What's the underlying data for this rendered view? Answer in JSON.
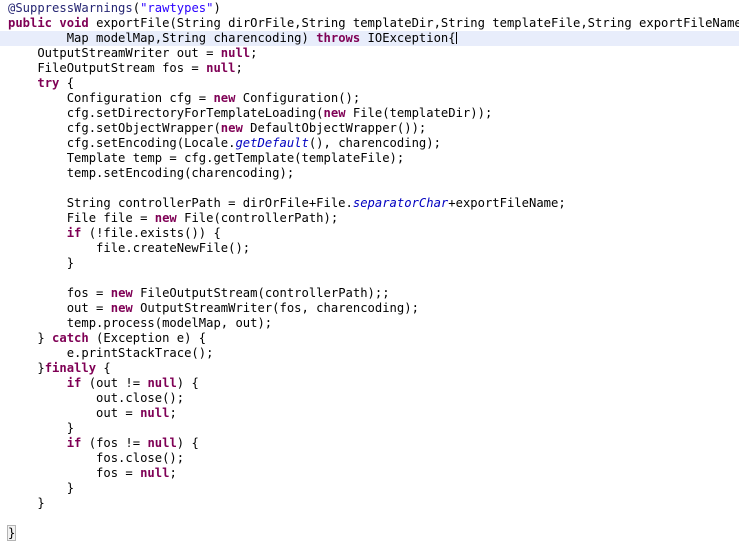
{
  "editor": {
    "language": "java",
    "theme": {
      "background": "#ffffff",
      "foreground": "#000000",
      "keyword": "#7f0055",
      "string": "#2a00ff",
      "annotation": "#262673",
      "static_member": "#0000c0",
      "current_line_highlight": "#e8edfb",
      "bracket_match_outline": "#b4b4b4"
    },
    "cursor": {
      "line_index": 1,
      "visible": true
    },
    "bracket_match": {
      "line_index": 35,
      "text": "}"
    },
    "lines": [
      {
        "index": 0,
        "current": false,
        "tokens": [
          {
            "t": "@SuppressWarnings",
            "c": "ann"
          },
          {
            "t": "(",
            "c": "plain"
          },
          {
            "t": "\"rawtypes\"",
            "c": "str"
          },
          {
            "t": ")",
            "c": "plain"
          }
        ]
      },
      {
        "index": 1,
        "current": false,
        "tokens": [
          {
            "t": "public",
            "c": "kw"
          },
          {
            "t": " ",
            "c": "plain"
          },
          {
            "t": "void",
            "c": "kw"
          },
          {
            "t": " exportFile(String dirOrFile,String templateDir,String templateFile,String exportFileName,",
            "c": "plain"
          }
        ]
      },
      {
        "index": 2,
        "current": true,
        "tokens": [
          {
            "t": "        Map modelMap,String charencoding) ",
            "c": "plain"
          },
          {
            "t": "throws",
            "c": "kw"
          },
          {
            "t": " IOException{",
            "c": "plain"
          }
        ],
        "cursor_after": true
      },
      {
        "index": 3,
        "current": false,
        "tokens": [
          {
            "t": "    OutputStreamWriter out = ",
            "c": "plain"
          },
          {
            "t": "null",
            "c": "kw"
          },
          {
            "t": ";",
            "c": "plain"
          }
        ]
      },
      {
        "index": 4,
        "current": false,
        "tokens": [
          {
            "t": "    FileOutputStream fos = ",
            "c": "plain"
          },
          {
            "t": "null",
            "c": "kw"
          },
          {
            "t": ";",
            "c": "plain"
          }
        ]
      },
      {
        "index": 5,
        "current": false,
        "tokens": [
          {
            "t": "    ",
            "c": "plain"
          },
          {
            "t": "try",
            "c": "kw"
          },
          {
            "t": " {",
            "c": "plain"
          }
        ]
      },
      {
        "index": 6,
        "current": false,
        "tokens": [
          {
            "t": "        Configuration cfg = ",
            "c": "plain"
          },
          {
            "t": "new",
            "c": "kw"
          },
          {
            "t": " Configuration();",
            "c": "plain"
          }
        ]
      },
      {
        "index": 7,
        "current": false,
        "tokens": [
          {
            "t": "        cfg.setDirectoryForTemplateLoading(",
            "c": "plain"
          },
          {
            "t": "new",
            "c": "kw"
          },
          {
            "t": " File(templateDir));",
            "c": "plain"
          }
        ]
      },
      {
        "index": 8,
        "current": false,
        "tokens": [
          {
            "t": "        cfg.setObjectWrapper(",
            "c": "plain"
          },
          {
            "t": "new",
            "c": "kw"
          },
          {
            "t": " DefaultObjectWrapper());",
            "c": "plain"
          }
        ]
      },
      {
        "index": 9,
        "current": false,
        "tokens": [
          {
            "t": "        cfg.setEncoding(Locale.",
            "c": "plain"
          },
          {
            "t": "getDefault",
            "c": "stat"
          },
          {
            "t": "(), charencoding);",
            "c": "plain"
          }
        ]
      },
      {
        "index": 10,
        "current": false,
        "tokens": [
          {
            "t": "        Template temp = cfg.getTemplate(templateFile);",
            "c": "plain"
          }
        ]
      },
      {
        "index": 11,
        "current": false,
        "tokens": [
          {
            "t": "        temp.setEncoding(charencoding);",
            "c": "plain"
          }
        ]
      },
      {
        "index": 12,
        "current": false,
        "tokens": [
          {
            "t": "",
            "c": "plain"
          }
        ]
      },
      {
        "index": 13,
        "current": false,
        "tokens": [
          {
            "t": "        String controllerPath = dirOrFile+File.",
            "c": "plain"
          },
          {
            "t": "separatorChar",
            "c": "stat"
          },
          {
            "t": "+exportFileName;",
            "c": "plain"
          }
        ]
      },
      {
        "index": 14,
        "current": false,
        "tokens": [
          {
            "t": "        File file = ",
            "c": "plain"
          },
          {
            "t": "new",
            "c": "kw"
          },
          {
            "t": " File(controllerPath);",
            "c": "plain"
          }
        ]
      },
      {
        "index": 15,
        "current": false,
        "tokens": [
          {
            "t": "        ",
            "c": "plain"
          },
          {
            "t": "if",
            "c": "kw"
          },
          {
            "t": " (!file.exists()) {",
            "c": "plain"
          }
        ]
      },
      {
        "index": 16,
        "current": false,
        "tokens": [
          {
            "t": "            file.createNewFile();",
            "c": "plain"
          }
        ]
      },
      {
        "index": 17,
        "current": false,
        "tokens": [
          {
            "t": "        }",
            "c": "plain"
          }
        ]
      },
      {
        "index": 18,
        "current": false,
        "tokens": [
          {
            "t": "",
            "c": "plain"
          }
        ]
      },
      {
        "index": 19,
        "current": false,
        "tokens": [
          {
            "t": "        fos = ",
            "c": "plain"
          },
          {
            "t": "new",
            "c": "kw"
          },
          {
            "t": " FileOutputStream(controllerPath);;",
            "c": "plain"
          }
        ]
      },
      {
        "index": 20,
        "current": false,
        "tokens": [
          {
            "t": "        out = ",
            "c": "plain"
          },
          {
            "t": "new",
            "c": "kw"
          },
          {
            "t": " OutputStreamWriter(fos, charencoding);",
            "c": "plain"
          }
        ]
      },
      {
        "index": 21,
        "current": false,
        "tokens": [
          {
            "t": "        temp.process(modelMap, out);",
            "c": "plain"
          }
        ]
      },
      {
        "index": 22,
        "current": false,
        "tokens": [
          {
            "t": "    } ",
            "c": "plain"
          },
          {
            "t": "catch",
            "c": "kw"
          },
          {
            "t": " (Exception e) {",
            "c": "plain"
          }
        ]
      },
      {
        "index": 23,
        "current": false,
        "tokens": [
          {
            "t": "        e.printStackTrace();",
            "c": "plain"
          }
        ]
      },
      {
        "index": 24,
        "current": false,
        "tokens": [
          {
            "t": "    }",
            "c": "plain"
          },
          {
            "t": "finally",
            "c": "kw"
          },
          {
            "t": " {",
            "c": "plain"
          }
        ]
      },
      {
        "index": 25,
        "current": false,
        "tokens": [
          {
            "t": "        ",
            "c": "plain"
          },
          {
            "t": "if",
            "c": "kw"
          },
          {
            "t": " (out != ",
            "c": "plain"
          },
          {
            "t": "null",
            "c": "kw"
          },
          {
            "t": ") {",
            "c": "plain"
          }
        ]
      },
      {
        "index": 26,
        "current": false,
        "tokens": [
          {
            "t": "            out.close();",
            "c": "plain"
          }
        ]
      },
      {
        "index": 27,
        "current": false,
        "tokens": [
          {
            "t": "            out = ",
            "c": "plain"
          },
          {
            "t": "null",
            "c": "kw"
          },
          {
            "t": ";",
            "c": "plain"
          }
        ]
      },
      {
        "index": 28,
        "current": false,
        "tokens": [
          {
            "t": "        }",
            "c": "plain"
          }
        ]
      },
      {
        "index": 29,
        "current": false,
        "tokens": [
          {
            "t": "        ",
            "c": "plain"
          },
          {
            "t": "if",
            "c": "kw"
          },
          {
            "t": " (fos != ",
            "c": "plain"
          },
          {
            "t": "null",
            "c": "kw"
          },
          {
            "t": ") {",
            "c": "plain"
          }
        ]
      },
      {
        "index": 30,
        "current": false,
        "tokens": [
          {
            "t": "            fos.close();",
            "c": "plain"
          }
        ]
      },
      {
        "index": 31,
        "current": false,
        "tokens": [
          {
            "t": "            fos = ",
            "c": "plain"
          },
          {
            "t": "null",
            "c": "kw"
          },
          {
            "t": ";",
            "c": "plain"
          }
        ]
      },
      {
        "index": 32,
        "current": false,
        "tokens": [
          {
            "t": "        }",
            "c": "plain"
          }
        ]
      },
      {
        "index": 33,
        "current": false,
        "tokens": [
          {
            "t": "    }",
            "c": "plain"
          }
        ]
      },
      {
        "index": 34,
        "current": false,
        "tokens": [
          {
            "t": "",
            "c": "plain"
          }
        ]
      },
      {
        "index": 35,
        "current": false,
        "bracket_match_line": true,
        "tokens": [
          {
            "t": "}",
            "c": "plain",
            "bracket_match": true
          }
        ]
      }
    ]
  }
}
